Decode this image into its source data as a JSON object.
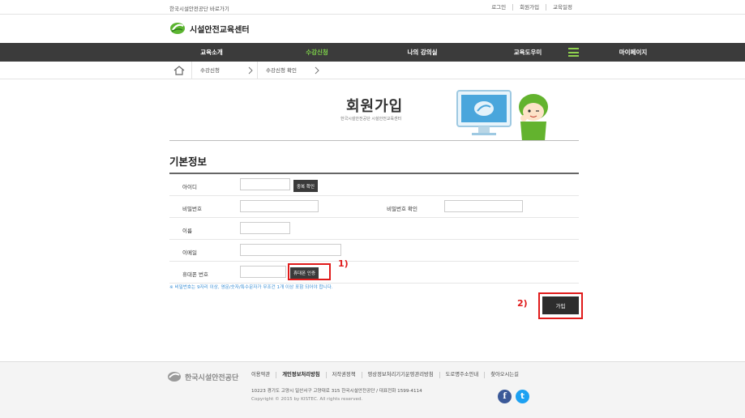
{
  "topbar": {
    "shortcut": "한국시설안전공단 바로가기",
    "util_links": [
      "로그인",
      "회원가입",
      "교육일정"
    ]
  },
  "logo": {
    "text": "시설안전교육센터"
  },
  "gnb": {
    "items": [
      "교육소개",
      "수강신청",
      "나의 강의실",
      "교육도우미",
      "마이페이지"
    ],
    "active_index": 1,
    "active_color": "#7fd44a"
  },
  "breadcrumb": {
    "items": [
      "수강신청",
      "수강신청 확인"
    ]
  },
  "hero": {
    "title": "회원가입",
    "subtitle": "한국시설안전공단 시설안전교육센터"
  },
  "section": {
    "title": "기본정보"
  },
  "form": {
    "id_label": "아이디",
    "id_value": "",
    "dup_check_label": "중복 확인",
    "password_label": "비밀번호",
    "password_value": "",
    "password_confirm_label": "비밀번호 확인",
    "password_confirm_value": "",
    "name_label": "이름",
    "name_value": "",
    "email_label": "이메일",
    "email_value": "",
    "phone_label": "휴대폰 번호",
    "phone_value": "",
    "phone_verify_label": "휴대폰 인증",
    "note": "※ 비밀번호는 9자리 이상, 영문/숫자/특수문자가 무조건 1개 이상 포함 되어야 합니다."
  },
  "annotations": {
    "first": "1)",
    "second": "2)",
    "color": "#e01b1b"
  },
  "actions": {
    "join_label": "가입"
  },
  "footer": {
    "logo_text": "한국시설안전공단",
    "links": [
      "이용약관",
      "개인정보처리방침",
      "저작권정책",
      "영상정보처리기기운영관리방침",
      "도로명주소안내",
      "찾아오시는길"
    ],
    "bold_index": 1,
    "address": "10223   경기도 고양시 일산서구 고양대로 315 한국시설안전공단  / 대표전화 1599-4114",
    "copyright": "Copyright © 2015 by KISTEC. All rights reserved.",
    "facebook_glyph": "f",
    "twitter_glyph": "t",
    "facebook_color": "#3b5998",
    "twitter_color": "#1da1f2"
  }
}
